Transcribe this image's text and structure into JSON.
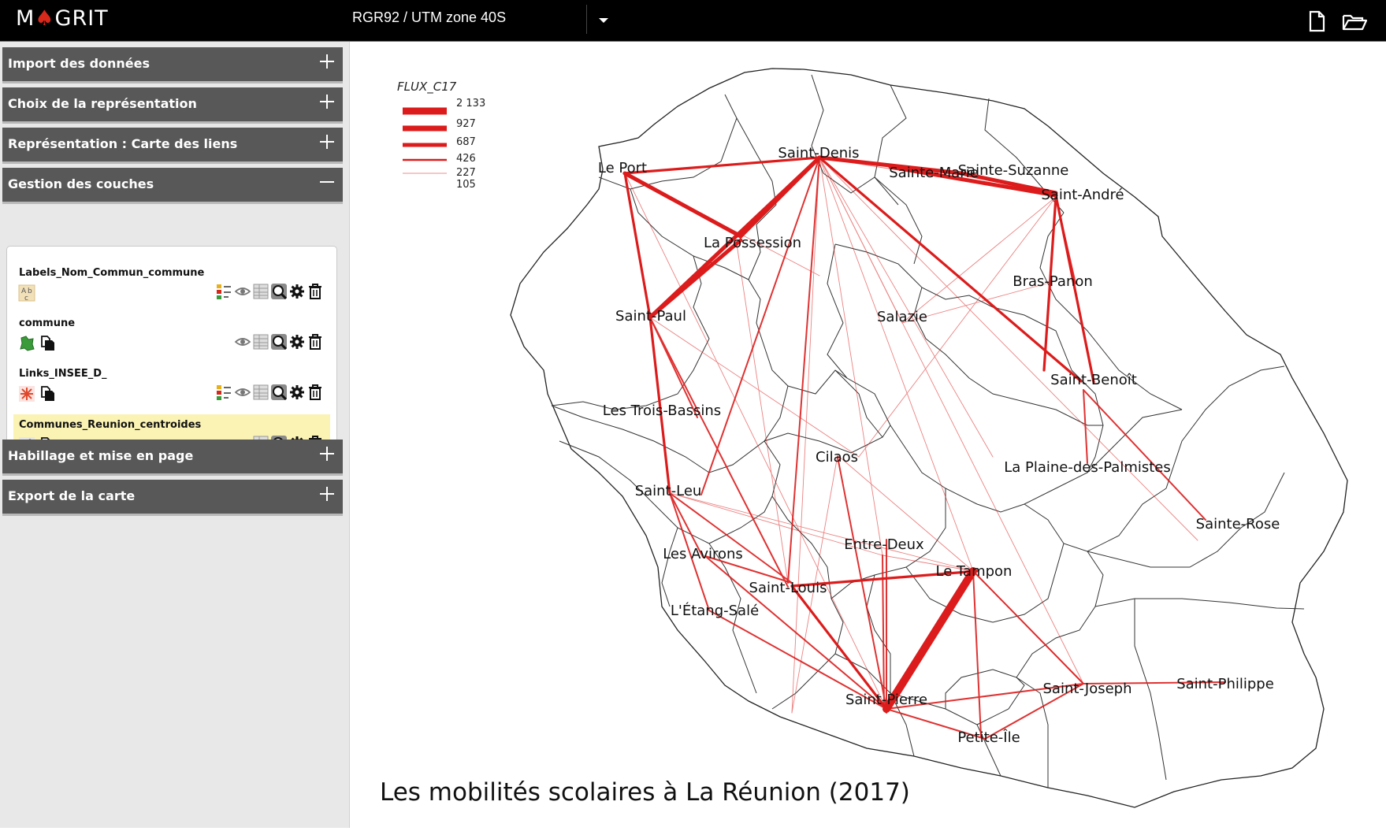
{
  "app": {
    "logo_text_left": "M",
    "logo_text_right": "GRIT",
    "projection": "RGR92 / UTM zone 40S"
  },
  "sidebar": {
    "sections_top": [
      {
        "label": "Import des données"
      },
      {
        "label": "Choix de la représentation"
      },
      {
        "label": "Représentation : Carte des liens"
      },
      {
        "label": "Gestion des couches"
      }
    ],
    "sections_bottom": [
      {
        "label": "Habillage et mise en page"
      },
      {
        "label": "Export de la carte"
      }
    ],
    "layers": [
      {
        "name": "Labels_Nom_Commun_commune"
      },
      {
        "name": "commune"
      },
      {
        "name": "Links_INSEE_D_"
      },
      {
        "name": "Communes_Reunion_centroides"
      }
    ]
  },
  "map": {
    "title": "Les mobilités scolaires à La Réunion (2017)",
    "legend": {
      "title": "FLUX_C17",
      "values": [
        "2 133",
        "927",
        "687",
        "426",
        "227",
        "105"
      ]
    },
    "communes": [
      "Le Port",
      "Saint-Denis",
      "Sainte-Marie",
      "Sainte-Suzanne",
      "Saint-André",
      "La Possession",
      "Bras-Panon",
      "Saint-Paul",
      "Salazie",
      "Saint-Benoît",
      "Les Trois-Bassins",
      "Cilaos",
      "La Plaine-des-Palmistes",
      "Saint-Leu",
      "Sainte-Rose",
      "Entre-Deux",
      "Les Avirons",
      "Le Tampon",
      "Saint-Louis",
      "L'Étang-Salé",
      "Saint-Pierre",
      "Saint-Joseph",
      "Saint-Philippe",
      "Petite-Île"
    ],
    "colors": {
      "flux": "#dc1c1c",
      "border": "#333333"
    }
  }
}
